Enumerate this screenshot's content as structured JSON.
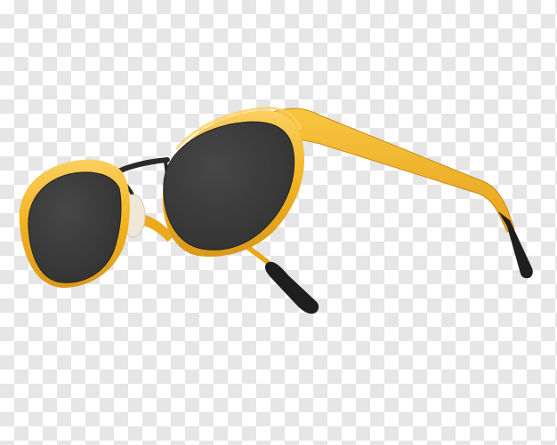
{
  "image": {
    "subject": "sunglasses-icon",
    "background": "transparency-checkerboard",
    "colors": {
      "frame": "#F2B320",
      "frame_shadow": "#D9981A",
      "frame_highlight": "#FAD060",
      "lens": "#3A3A3A",
      "lens_edge": "#222222",
      "bridge_metal": "#2A2A2A",
      "nose_pad": "#EFE8D8",
      "temple_tip": "#1E1E1E",
      "checker_light": "#FFFFFF",
      "checker_dark": "#E6E6E6"
    }
  }
}
